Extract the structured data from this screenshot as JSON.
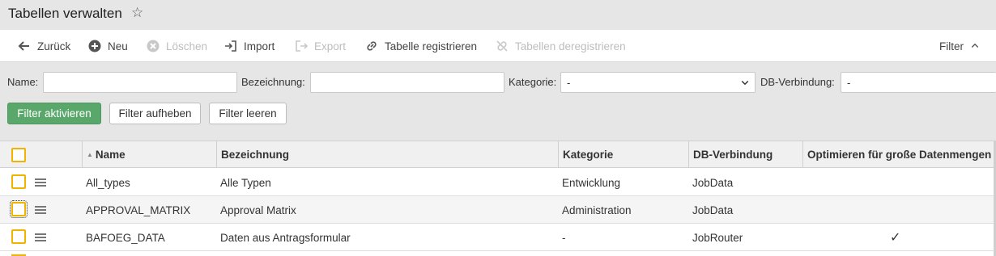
{
  "title": "Tabellen verwalten",
  "toolbar": {
    "back": "Zurück",
    "new": "Neu",
    "delete": "Löschen",
    "import": "Import",
    "export": "Export",
    "register": "Tabelle registrieren",
    "unregister": "Tabellen deregistrieren",
    "filter": "Filter"
  },
  "filter": {
    "name_label": "Name:",
    "name_value": "",
    "desc_label": "Bezeichnung:",
    "desc_value": "",
    "category_label": "Kategorie:",
    "category_value": "-",
    "db_label": "DB-Verbindung:",
    "db_value": "-",
    "activate": "Filter aktivieren",
    "remove": "Filter aufheben",
    "clear": "Filter leeren"
  },
  "columns": {
    "name": "Name",
    "bezeichnung": "Bezeichnung",
    "kategorie": "Kategorie",
    "db": "DB-Verbindung",
    "optimize": "Optimieren für große Datenmengen"
  },
  "rows": [
    {
      "name": "All_types",
      "bezeichnung": "Alle Typen",
      "kategorie": "Entwicklung",
      "db": "JobData",
      "optimize": ""
    },
    {
      "name": "APPROVAL_MATRIX",
      "bezeichnung": "Approval Matrix",
      "kategorie": "Administration",
      "db": "JobData",
      "optimize": ""
    },
    {
      "name": "BAFOEG_DATA",
      "bezeichnung": "Daten aus Antragsformular",
      "kategorie": "-",
      "db": "JobRouter",
      "optimize": "✓"
    }
  ],
  "colors": {
    "primary_button": "#5aa76b",
    "checkbox_border": "#f0b400"
  }
}
